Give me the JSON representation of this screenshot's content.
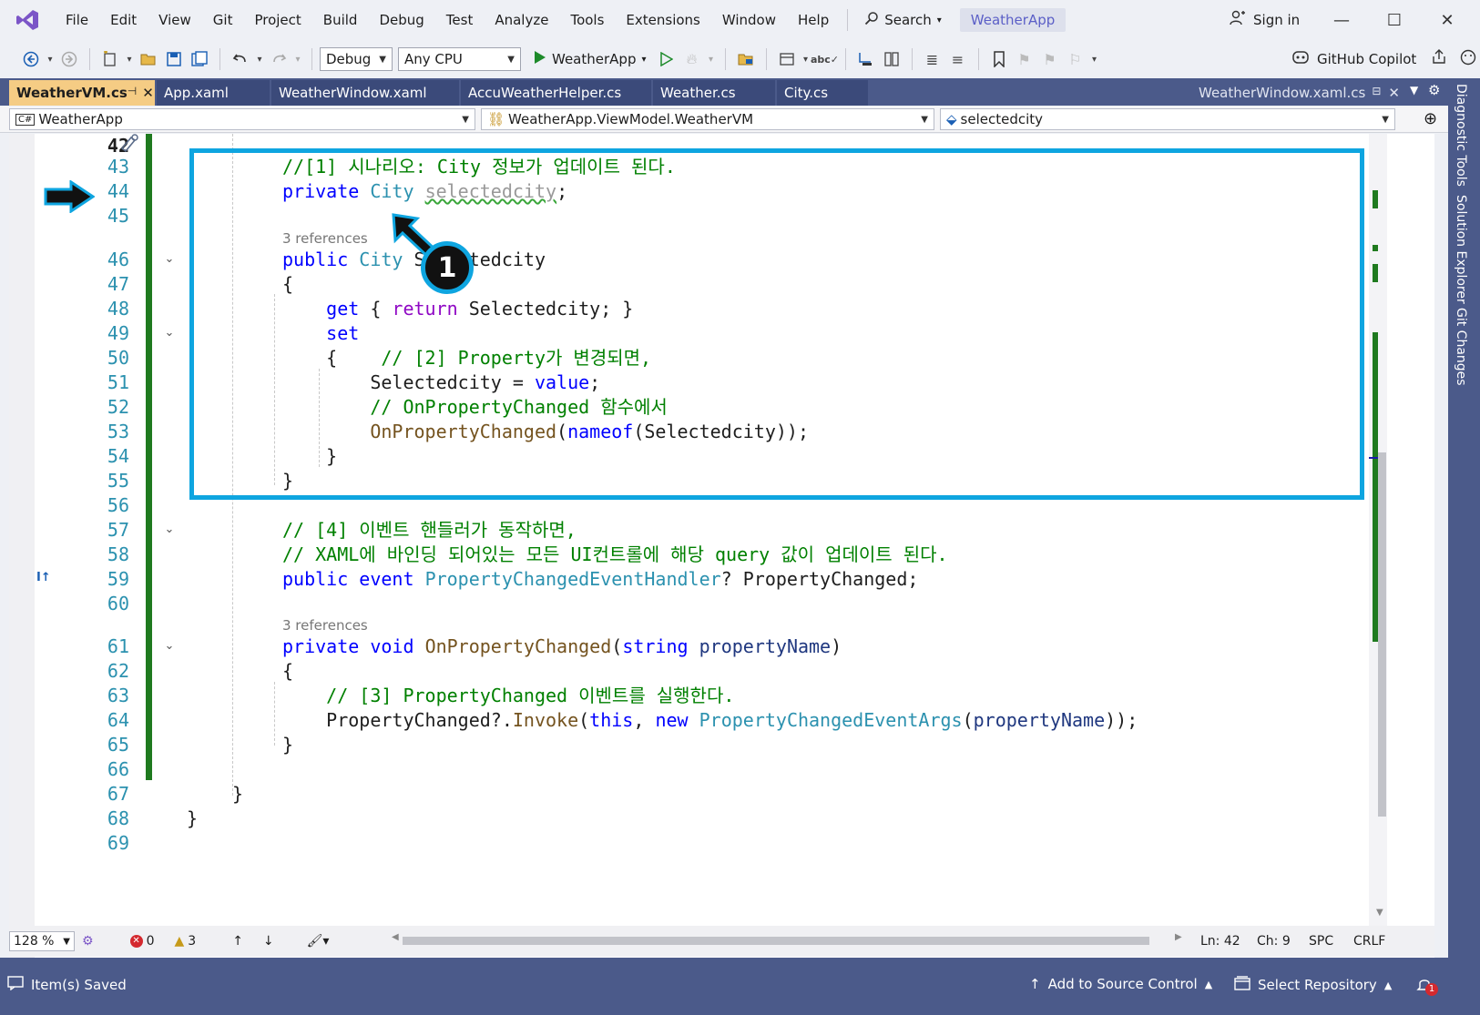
{
  "menu": {
    "items": [
      "File",
      "Edit",
      "View",
      "Git",
      "Project",
      "Build",
      "Debug",
      "Test",
      "Analyze",
      "Tools",
      "Extensions",
      "Window",
      "Help"
    ],
    "search_label": "Search",
    "project_name": "WeatherApp",
    "sign_in": "Sign in"
  },
  "toolbar": {
    "configuration": "Debug",
    "platform": "Any CPU",
    "run_target": "WeatherApp",
    "copilot": "GitHub Copilot"
  },
  "tabs": [
    {
      "label": "WeatherVM.cs",
      "active": true
    },
    {
      "label": "App.xaml"
    },
    {
      "label": "WeatherWindow.xaml"
    },
    {
      "label": "AccuWeatherHelper.cs"
    },
    {
      "label": "Weather.cs"
    },
    {
      "label": "City.cs"
    }
  ],
  "preview_tab": "WeatherWindow.xaml.cs",
  "navbar": {
    "project": "WeatherApp",
    "type": "WeatherApp.ViewModel.WeatherVM",
    "member": "selectedcity"
  },
  "editor": {
    "codelens_1": "3 references",
    "codelens_2": "3 references",
    "line_numbers": [
      "42",
      "43",
      "44",
      "45",
      "46",
      "47",
      "48",
      "49",
      "50",
      "51",
      "52",
      "53",
      "54",
      "55",
      "56",
      "57",
      "58",
      "59",
      "60",
      "61",
      "62",
      "63",
      "64",
      "65",
      "66",
      "67",
      "68",
      "69"
    ],
    "step_badge": "1"
  },
  "side_tabs": [
    "Diagnostic Tools",
    "Solution Explorer",
    "Git Changes"
  ],
  "editor_status": {
    "zoom": "128 %",
    "errors": "0",
    "warnings": "3",
    "line": "Ln: 42",
    "col": "Ch: 9",
    "whitespace": "SPC",
    "line_ending": "CRLF"
  },
  "statusbar": {
    "message": "Item(s) Saved",
    "source_control": "Add to Source Control",
    "repository": "Select Repository",
    "notifications": "1"
  },
  "colors": {
    "accent_tab": "#f5cc84",
    "chrome": "#4b5a8a",
    "highlight": "#0ea5e0"
  }
}
